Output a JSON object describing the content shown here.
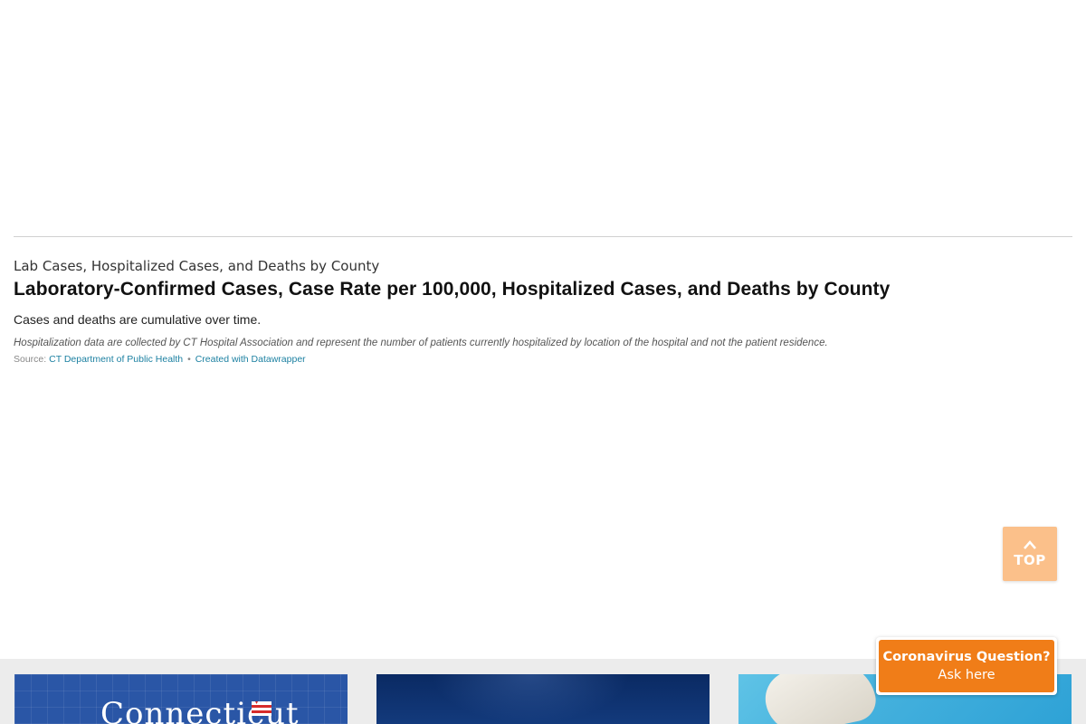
{
  "section": {
    "label": "Lab Cases, Hospitalized Cases, and Deaths by County",
    "chart_title": "Laboratory-Confirmed Cases, Case Rate per 100,000, Hospitalized Cases, and Deaths by County",
    "intro": "Cases and deaths are cumulative over time.",
    "notes": "Hospitalization data are collected by CT Hospital Association and represent the number of patients currently hospitalized by location of the hospital and not the patient residence.",
    "source_prefix": "Source:",
    "source_link": "CT Department of Public Health",
    "separator": "•",
    "created_with": "Created with Datawrapper"
  },
  "top_button": {
    "label": "TOP",
    "icon": "chevron-up-icon"
  },
  "chat": {
    "title": "Coronavirus Question?",
    "subtitle": "Ask here",
    "color": "#f07d18"
  },
  "cards": [
    {
      "logo_text": "Connecticut"
    },
    {},
    {}
  ]
}
